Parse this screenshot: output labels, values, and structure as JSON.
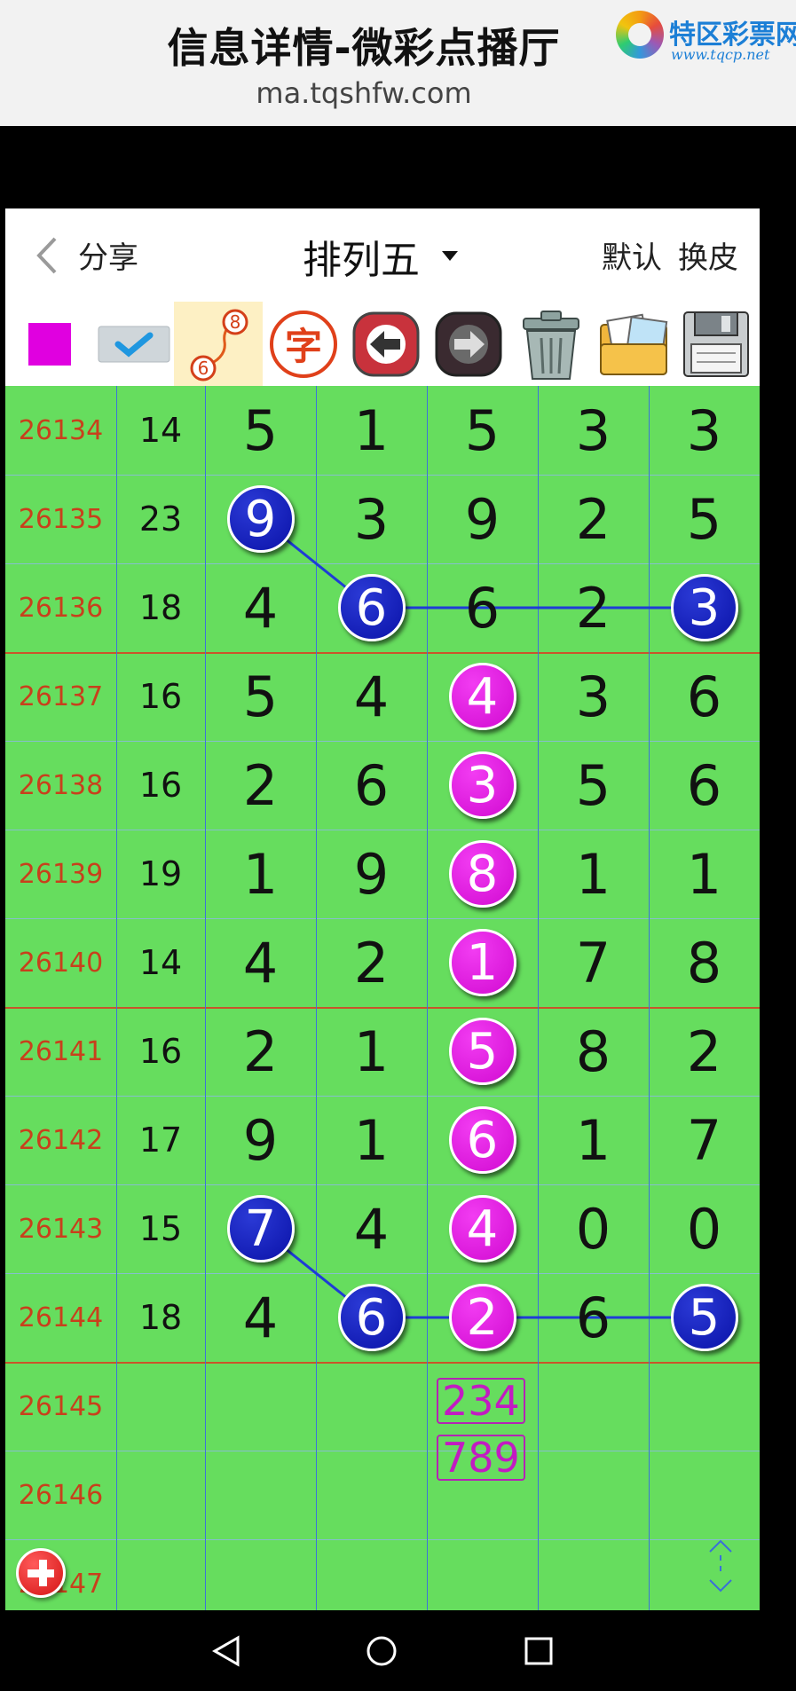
{
  "banner": {
    "title": "信息详情-微彩点播厅",
    "url": "ma.tqshfw.com",
    "logo_name": "特区彩票网",
    "logo_url": "www.tqcp.net"
  },
  "nav": {
    "share": "分享",
    "title": "排列五",
    "default": "默认",
    "skin": "换皮"
  },
  "toolbar": {
    "icons": [
      "color-swatch-icon",
      "check-icon",
      "connect-line-icon",
      "font-icon",
      "back-arrow-icon",
      "forward-arrow-icon",
      "trash-icon",
      "photos-icon",
      "floppy-save-icon"
    ],
    "swatch_color": "#e000e0",
    "line_icon_numbers": [
      "8",
      "6"
    ],
    "font_char": "字"
  },
  "colors": {
    "grid_bg": "#66dd5e",
    "issue_text": "#c8401c",
    "ball_blue": "#0a12a8",
    "ball_magenta": "#d10ad1",
    "line_blue": "#1e3cd6"
  },
  "rows": [
    {
      "issue": "26134",
      "sum": "14",
      "digits": [
        "5",
        "1",
        "5",
        "3",
        "3"
      ],
      "balls": [
        null,
        null,
        null,
        null,
        null
      ]
    },
    {
      "issue": "26135",
      "sum": "23",
      "digits": [
        "9",
        "3",
        "9",
        "2",
        "5"
      ],
      "balls": [
        "blue",
        null,
        null,
        null,
        null
      ]
    },
    {
      "issue": "26136",
      "sum": "18",
      "digits": [
        "4",
        "6",
        "6",
        "2",
        "3"
      ],
      "balls": [
        null,
        "blue",
        null,
        null,
        "blue"
      ]
    },
    {
      "issue": "26137",
      "sum": "16",
      "digits": [
        "5",
        "4",
        "4",
        "3",
        "6"
      ],
      "balls": [
        null,
        null,
        "magenta",
        null,
        null
      ]
    },
    {
      "issue": "26138",
      "sum": "16",
      "digits": [
        "2",
        "6",
        "3",
        "5",
        "6"
      ],
      "balls": [
        null,
        null,
        "magenta",
        null,
        null
      ]
    },
    {
      "issue": "26139",
      "sum": "19",
      "digits": [
        "1",
        "9",
        "8",
        "1",
        "1"
      ],
      "balls": [
        null,
        null,
        "magenta",
        null,
        null
      ]
    },
    {
      "issue": "26140",
      "sum": "14",
      "digits": [
        "4",
        "2",
        "1",
        "7",
        "8"
      ],
      "balls": [
        null,
        null,
        "magenta",
        null,
        null
      ]
    },
    {
      "issue": "26141",
      "sum": "16",
      "digits": [
        "2",
        "1",
        "5",
        "8",
        "2"
      ],
      "balls": [
        null,
        null,
        "magenta",
        null,
        null
      ]
    },
    {
      "issue": "26142",
      "sum": "17",
      "digits": [
        "9",
        "1",
        "6",
        "1",
        "7"
      ],
      "balls": [
        null,
        null,
        "magenta",
        null,
        null
      ]
    },
    {
      "issue": "26143",
      "sum": "15",
      "digits": [
        "7",
        "4",
        "4",
        "0",
        "0"
      ],
      "balls": [
        "blue",
        null,
        "magenta",
        null,
        null
      ]
    },
    {
      "issue": "26144",
      "sum": "18",
      "digits": [
        "4",
        "6",
        "2",
        "6",
        "5"
      ],
      "balls": [
        null,
        "blue",
        "magenta",
        null,
        "blue"
      ]
    },
    {
      "issue": "26145",
      "sum": "",
      "digits": [
        "",
        "",
        "",
        "",
        ""
      ],
      "balls": [
        null,
        null,
        null,
        null,
        null
      ]
    },
    {
      "issue": "26146",
      "sum": "",
      "digits": [
        "",
        "",
        "",
        "",
        ""
      ],
      "balls": [
        null,
        null,
        null,
        null,
        null
      ]
    },
    {
      "issue": "26147",
      "sum": "",
      "digits": [
        "",
        "",
        "",
        "",
        ""
      ],
      "balls": [
        null,
        null,
        null,
        null,
        null
      ]
    }
  ],
  "prediction": {
    "row_index": 11,
    "column": 2,
    "lines": [
      "234",
      "789"
    ]
  },
  "connector_groups": [
    [
      [
        1,
        0
      ],
      [
        2,
        1
      ],
      [
        2,
        4
      ]
    ],
    [
      [
        9,
        0
      ],
      [
        10,
        1
      ],
      [
        10,
        4
      ]
    ]
  ],
  "section_dividers_after_rows": [
    2,
    6,
    10
  ]
}
